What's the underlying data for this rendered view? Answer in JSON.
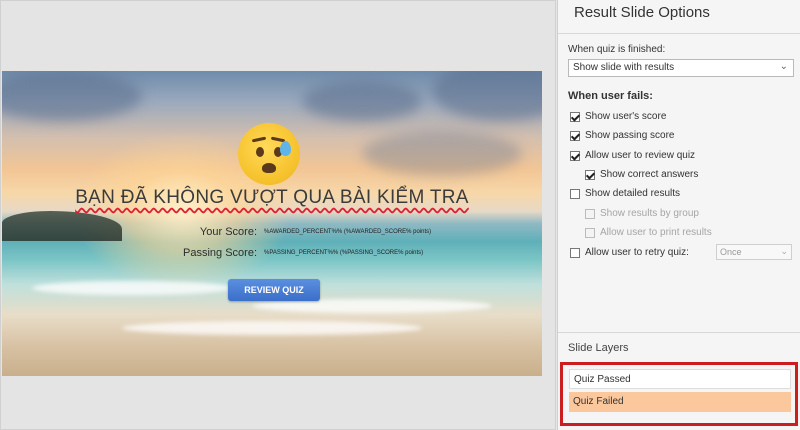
{
  "slide": {
    "title": "BẠN ĐÃ KHÔNG VƯỢT QUA BÀI KIỂM TRA",
    "your_score_label": "Your Score:",
    "your_score_value": "%AWARDED_PERCENT%% (%AWARDED_SCORE% points)",
    "passing_score_label": "Passing Score:",
    "passing_score_value": "%PASSING_PERCENT%% (%PASSING_SCORE% points)",
    "review_button": "REVIEW QUIZ",
    "emoji_icon": "anxious-face-with-sweat-icon"
  },
  "panel": {
    "title": "Result Slide Options",
    "when_finished_label": "When quiz is finished:",
    "when_finished_value": "Show slide with results",
    "when_fails_label": "When user fails:",
    "options": [
      {
        "label": "Show user's score",
        "checked": true,
        "disabled": false
      },
      {
        "label": "Show passing score",
        "checked": true,
        "disabled": false
      },
      {
        "label": "Allow user to review quiz",
        "checked": true,
        "disabled": false
      },
      {
        "label": "Show correct answers",
        "checked": true,
        "disabled": false
      },
      {
        "label": "Show detailed results",
        "checked": false,
        "disabled": false
      },
      {
        "label": "Show results by group",
        "checked": false,
        "disabled": true
      },
      {
        "label": "Allow user to print results",
        "checked": false,
        "disabled": true
      },
      {
        "label": "Allow user to retry quiz:",
        "checked": false,
        "disabled": false
      }
    ],
    "retry_value": "Once",
    "layers_title": "Slide Layers",
    "layers": [
      "Quiz Passed",
      "Quiz Failed"
    ],
    "selected_layer": "Quiz Failed"
  },
  "colors": {
    "highlight_box": "#cc1e1e",
    "selected_layer_bg": "#fbc89e",
    "button_blue": "#4a7fd6"
  }
}
